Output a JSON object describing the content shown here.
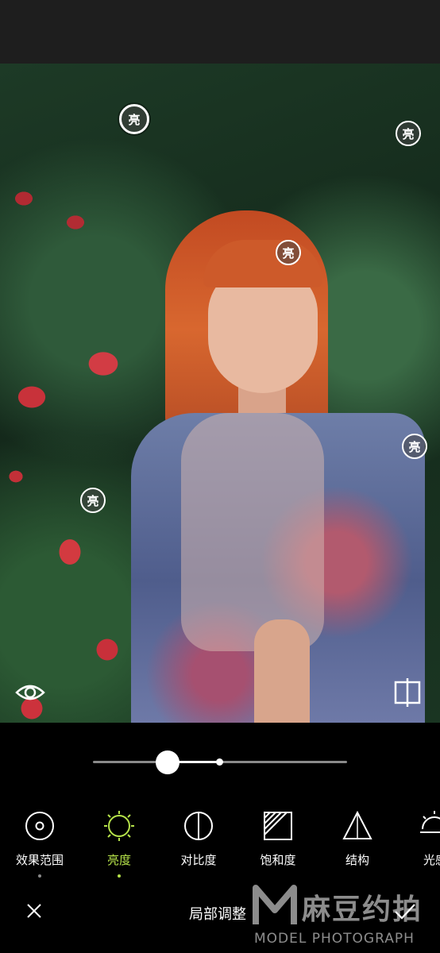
{
  "markers": {
    "label": "亮"
  },
  "slider": {
    "value_fraction": 0.29
  },
  "tools": [
    {
      "label": "效果范围",
      "icon": "target-icon"
    },
    {
      "label": "亮度",
      "icon": "sun-icon"
    },
    {
      "label": "对比度",
      "icon": "contrast-icon"
    },
    {
      "label": "饱和度",
      "icon": "saturation-icon"
    },
    {
      "label": "结构",
      "icon": "triangle-icon"
    },
    {
      "label": "光感",
      "icon": "light-icon"
    }
  ],
  "active_tool_index": 1,
  "bottom_bar": {
    "title": "局部调整"
  },
  "watermark": {
    "chinese": "麻豆约拍",
    "english": "MODEL PHOTOGRAPH"
  },
  "colors": {
    "accent": "#b6e34a",
    "background": "#000000",
    "top_bar": "#1e1e1e"
  }
}
